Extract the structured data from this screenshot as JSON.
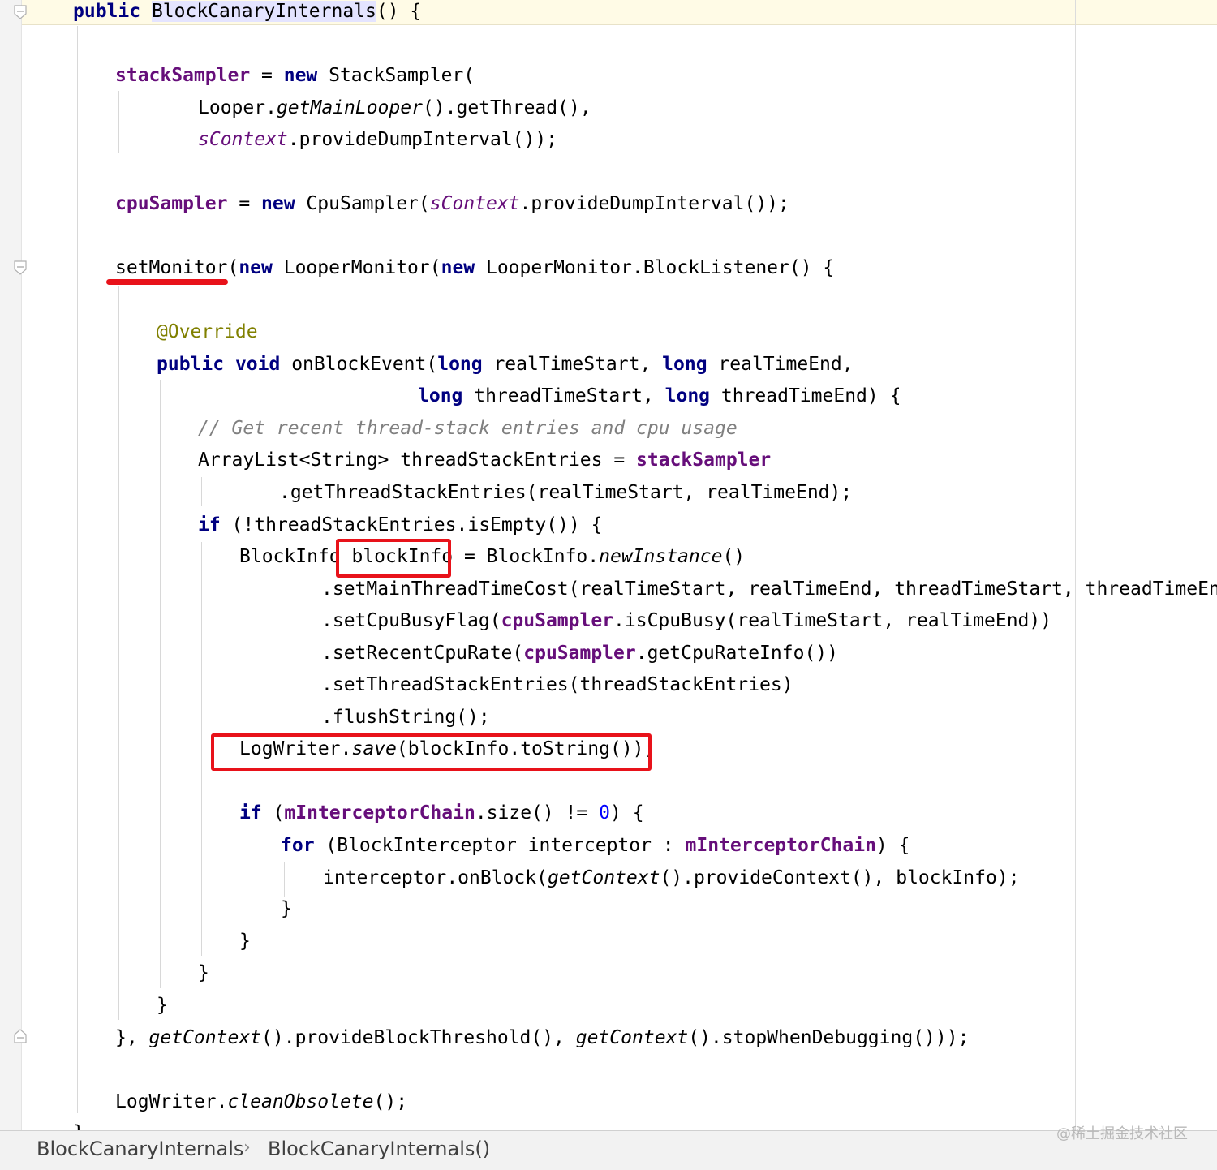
{
  "code": {
    "header_prefix": "public ",
    "header_name": "BlockCanaryInternals",
    "header_suffix": "() {",
    "l1_field": "stackSampler",
    "l1_eq": " = ",
    "l1_new": "new",
    "l1_rest": " StackSampler(",
    "l2_a": "Looper.",
    "l2_b": "getMainLooper",
    "l2_c": "().getThread(),",
    "l3_a": "sContext",
    "l3_b": ".provideDumpInterval());",
    "l4_field": "cpuSampler",
    "l4_eq": " = ",
    "l4_new": "new",
    "l4_mid": " CpuSampler(",
    "l4_ctx": "sContext",
    "l4_end": ".provideDumpInterval());",
    "l5_a": "setMonitor(",
    "l5_new1": "new",
    "l5_b": " LooperMonitor(",
    "l5_new2": "new",
    "l5_c": " LooperMonitor.BlockListener() {",
    "l6_annot": "@Override",
    "l7_public": "public",
    "l7_void": "void",
    "l7_a": " onBlockEvent(",
    "l7_long1": "long",
    "l7_b": " realTimeStart, ",
    "l7_long2": "long",
    "l7_c": " realTimeEnd,",
    "l8_long1": "long",
    "l8_a": " threadTimeStart, ",
    "l8_long2": "long",
    "l8_b": " threadTimeEnd) {",
    "l9_comment": "// Get recent thread-stack entries and cpu usage",
    "l10_a": "ArrayList<String> threadStackEntries = ",
    "l10_field": "stackSampler",
    "l11": ".getThreadStackEntries(realTimeStart, realTimeEnd);",
    "l12_if": "if",
    "l12_rest": " (!threadStackEntries.isEmpty()) {",
    "l13_a": "BlockInfo ",
    "l13_var": "blockInfo",
    "l13_b": " = BlockInfo.",
    "l13_c": "newInstance",
    "l13_d": "()",
    "l14": ".setMainThreadTimeCost(realTimeStart, realTimeEnd, threadTimeStart, threadTimeEnd)",
    "l15_a": ".setCpuBusyFlag(",
    "l15_field": "cpuSampler",
    "l15_b": ".isCpuBusy(realTimeStart, realTimeEnd))",
    "l16_a": ".setRecentCpuRate(",
    "l16_field": "cpuSampler",
    "l16_b": ".getCpuRateInfo())",
    "l17": ".setThreadStackEntries(threadStackEntries)",
    "l18": ".flushString();",
    "l19_a": "LogWriter.",
    "l19_b": "save",
    "l19_c": "(blockInfo.toString());",
    "l20_if": "if",
    "l20_a": " (",
    "l20_field": "mInterceptorChain",
    "l20_b": ".size() != ",
    "l20_num": "0",
    "l20_c": ") {",
    "l21_for": "for",
    "l21_a": " (BlockInterceptor interceptor : ",
    "l21_field": "mInterceptorChain",
    "l21_b": ") {",
    "l22_a": "interceptor.onBlock(",
    "l22_b": "getContext",
    "l22_c": "().provideContext(), blockInfo);",
    "close_brace": "}",
    "l27_a": "}, ",
    "l27_b": "getContext",
    "l27_c": "().provideBlockThreshold(), ",
    "l27_d": "getContext",
    "l27_e": "().stopWhenDebugging()));",
    "l28_a": "LogWriter.",
    "l28_b": "cleanObsolete",
    "l28_c": "();"
  },
  "breadcrumb": {
    "class_name": "BlockCanaryInternals",
    "separator": "›",
    "method_name": "BlockCanaryInternals()"
  },
  "watermark": "@稀土掘金技术社区",
  "colors": {
    "keyword": "#000080",
    "field": "#660e7a",
    "annotation": "#808000",
    "comment": "#808080",
    "number": "#0000ff",
    "highlight_red": "#e8121a"
  }
}
